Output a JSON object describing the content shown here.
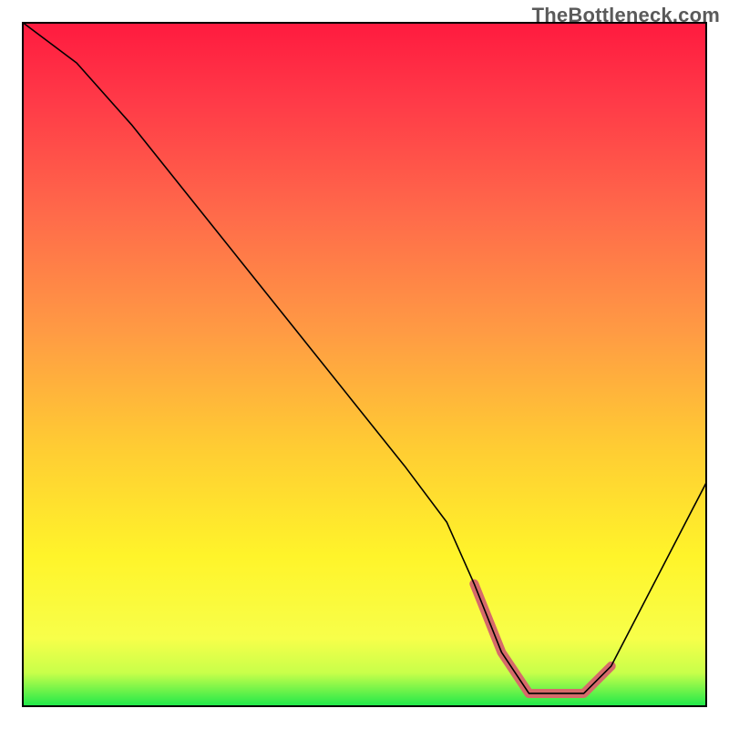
{
  "watermark": "TheBottleneck.com",
  "chart_data": {
    "type": "line",
    "title": "",
    "xlabel": "",
    "ylabel": "",
    "xlim": [
      0,
      100
    ],
    "ylim": [
      0,
      100
    ],
    "series": [
      {
        "name": "bottleneck-curve",
        "x": [
          0,
          8,
          16,
          24,
          32,
          40,
          48,
          56,
          62,
          66,
          70,
          74,
          78,
          82,
          86,
          100
        ],
        "values": [
          100,
          94,
          85,
          75,
          65,
          55,
          45,
          35,
          27,
          18,
          8,
          2,
          2,
          2,
          6,
          33
        ]
      },
      {
        "name": "optimal-range-marker",
        "x": [
          66,
          70,
          74,
          78,
          82,
          86
        ],
        "values": [
          18,
          8,
          2,
          2,
          2,
          6
        ]
      }
    ],
    "gradient_stops": [
      {
        "offset": 0.0,
        "color": "#ff1a3f"
      },
      {
        "offset": 0.12,
        "color": "#ff3b48"
      },
      {
        "offset": 0.28,
        "color": "#ff6a4a"
      },
      {
        "offset": 0.45,
        "color": "#ff9a44"
      },
      {
        "offset": 0.62,
        "color": "#ffcc33"
      },
      {
        "offset": 0.78,
        "color": "#fff42a"
      },
      {
        "offset": 0.9,
        "color": "#f7ff4a"
      },
      {
        "offset": 0.95,
        "color": "#c8ff4a"
      },
      {
        "offset": 1.0,
        "color": "#19e84a"
      }
    ],
    "curve_stroke": "#000000",
    "curve_stroke_width": 1.6,
    "marker_stroke": "#d66a6a",
    "marker_stroke_width": 10
  }
}
